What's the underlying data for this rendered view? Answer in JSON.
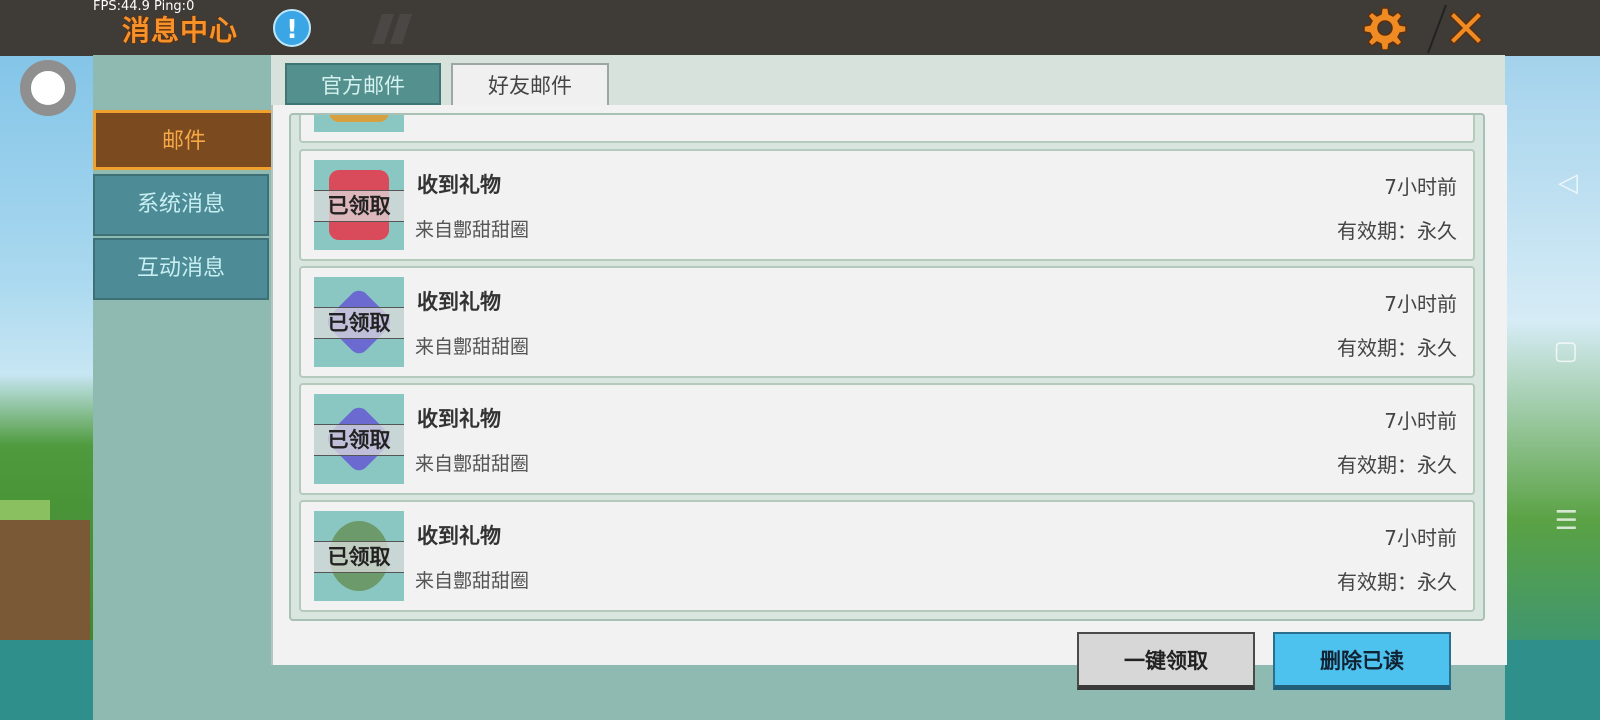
{
  "overlay": {
    "fps_text": "FPS:44.9  Ping:0"
  },
  "header": {
    "title": "消息中心",
    "info_icon_glyph": "!",
    "icons": [
      "info-icon",
      "gear-icon",
      "close-icon"
    ],
    "accent_color": "#f7922a"
  },
  "sidebar": {
    "items": [
      {
        "label": "邮件",
        "active": true
      },
      {
        "label": "系统消息",
        "active": false
      },
      {
        "label": "互动消息",
        "active": false
      }
    ]
  },
  "tabs": [
    {
      "label": "官方邮件",
      "active": false
    },
    {
      "label": "好友邮件",
      "active": true
    }
  ],
  "mails": [
    {
      "title": "收到礼物",
      "from": "来自鄷甜甜圈",
      "time": "7小时前",
      "expiry": "有效期：永久",
      "status": "已领取",
      "art_color": "#d94a5a"
    },
    {
      "title": "收到礼物",
      "from": "来自鄷甜甜圈",
      "time": "7小时前",
      "expiry": "有效期：永久",
      "status": "已领取",
      "art_color": "#6a6ad0"
    },
    {
      "title": "收到礼物",
      "from": "来自鄷甜甜圈",
      "time": "7小时前",
      "expiry": "有效期：永久",
      "status": "已领取",
      "art_color": "#6a6ad0"
    },
    {
      "title": "收到礼物",
      "from": "来自鄷甜甜圈",
      "time": "7小时前",
      "expiry": "有效期：永久",
      "status": "已领取",
      "art_color": "#6d9a6a"
    }
  ],
  "buttons": {
    "claim_all": "一键领取",
    "delete_read": "删除已读"
  },
  "system_nav": {
    "back_glyph": "◁",
    "home_glyph": "▢",
    "menu_glyph": "☰"
  }
}
